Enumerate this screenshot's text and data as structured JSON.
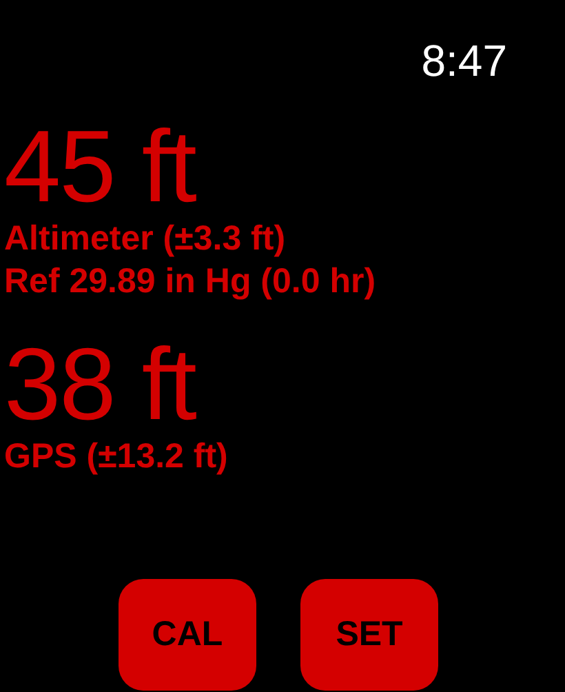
{
  "status_bar": {
    "time": "8:47"
  },
  "readings": [
    {
      "value": "45 ft",
      "details": [
        "Altimeter (±3.3 ft)",
        "Ref 29.89 in Hg (0.0 hr)"
      ]
    },
    {
      "value": "38 ft",
      "details": [
        "GPS (±13.2 ft)"
      ]
    }
  ],
  "buttons": [
    "CAL",
    "SET"
  ]
}
